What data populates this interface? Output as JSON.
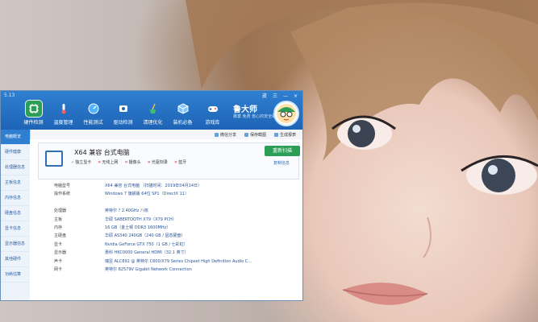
{
  "app": {
    "version": "5.13",
    "brand": "鲁大师",
    "slogan": "專業 免费 省心的安全助手",
    "colors": {
      "titlebar": "#1e64b6",
      "accent_green": "#2d9e58",
      "value_blue": "#2a5599"
    }
  },
  "toolbar": {
    "items": [
      {
        "label": "硬件检测",
        "icon": "chip-icon"
      },
      {
        "label": "温度管理",
        "icon": "thermometer-icon"
      },
      {
        "label": "性能测试",
        "icon": "gauge-icon"
      },
      {
        "label": "驱动检测",
        "icon": "driver-icon"
      },
      {
        "label": "清理优化",
        "icon": "broom-icon"
      },
      {
        "label": "装机必备",
        "icon": "cube-icon"
      },
      {
        "label": "游戏库",
        "icon": "gamepad-icon"
      }
    ]
  },
  "window_controls": [
    "皮",
    "三",
    "—",
    "×"
  ],
  "sidebar": {
    "items": [
      "电脑概览",
      "硬件健康",
      "处理器信息",
      "主板信息",
      "内存信息",
      "硬盘信息",
      "显卡信息",
      "显示器信息",
      "其他硬件",
      "功耗估算"
    ]
  },
  "actions": [
    "微信分享",
    "保存截图",
    "生成报表"
  ],
  "summary": {
    "title": "X64 兼容 台式电脑",
    "checks": [
      {
        "label": "独立显卡",
        "ok": true
      },
      {
        "label": "无线上网",
        "ok": false
      },
      {
        "label": "摄像头",
        "ok": false
      },
      {
        "label": "光驱刻录",
        "ok": false
      },
      {
        "label": "蓝牙",
        "ok": false
      }
    ],
    "rescan_label": "重新扫描",
    "copy_label": "复制信息"
  },
  "system_info": [
    {
      "k": "电脑型号",
      "v": "X64 兼容 台式电脑 （扫描时间：2019年04月14日）"
    },
    {
      "k": "操作系统",
      "v": "Windows 7 旗舰版 64位 SP1（DirectX 11）"
    },
    {
      "k": "",
      "v": ""
    },
    {
      "k": "处理器",
      "v": "英特尔 ? 2.40GHz 八核"
    },
    {
      "k": "主板",
      "v": "华硕 SABERTOOTH X79（X79 PCH）"
    },
    {
      "k": "内存",
      "v": "16 GB（金士顿 DDR3 1600MHz）"
    },
    {
      "k": "主硬盘",
      "v": "华硕 AS340 240GB（240 GB / 固态硬盘）"
    },
    {
      "k": "显卡",
      "v": "Nvidia GeForce GTX 750（1 GB / 七彩虹）"
    },
    {
      "k": "显示器",
      "v": "惠科 HKC0000 General HDMI（32.1 英寸）"
    },
    {
      "k": "声卡",
      "v": "瑞昱 ALC892 @ 英特尔 C600/X79 Series Chipset High Definition Audio C..."
    },
    {
      "k": "网卡",
      "v": "英特尔 82579V Gigabit Network Connection"
    }
  ]
}
